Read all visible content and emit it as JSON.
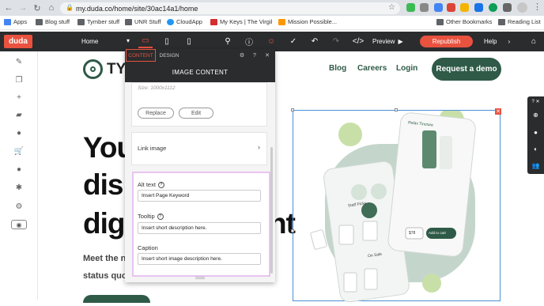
{
  "browser": {
    "url": "my.duda.co/home/site/30ac14a1/home",
    "bookmarks": [
      "Apps",
      "Blog stuff",
      "Tymber stuff",
      "UNR Stuff",
      "CloudApp",
      "My Keys | The Virgil",
      "Mission Possible..."
    ],
    "other_bookmarks": "Other Bookmarks",
    "reading_list": "Reading List"
  },
  "toolbar": {
    "logo": "duda",
    "page_select": "Home",
    "preview_label": "Preview",
    "republish_label": "Republish",
    "help_label": "Help"
  },
  "site": {
    "logo_text": "TYM",
    "nav": [
      "Blog",
      "Careers",
      "Login"
    ],
    "demo_button": "Request a demo",
    "hero_lines": [
      "You",
      "disp",
      "digi",
      "nt"
    ],
    "hero_sub_lines": [
      "Meet the n",
      "status quo"
    ]
  },
  "panel": {
    "tabs": [
      "CONTENT",
      "DESIGN"
    ],
    "title": "IMAGE CONTENT",
    "size_note": "Size: 1000x1112",
    "replace_label": "Replace",
    "edit_label": "Edit",
    "link_image_label": "Link image",
    "alt_text_label": "Alt text",
    "alt_text_value": "Insert Page Keyword",
    "tooltip_label": "Tooltip",
    "tooltip_value": "Insert short description here.",
    "caption_label": "Caption",
    "caption_value": "Insert short image description here."
  },
  "phone_image": {
    "header": "Relax Tincture",
    "price": "$78",
    "add_to_cart": "Add to cart",
    "staff_picks": "Staff Picks",
    "on_sale": "On Sale"
  },
  "colors": {
    "brand": "#e8523f",
    "site_green": "#2e5a47",
    "highlight": "#e8c5f0"
  }
}
